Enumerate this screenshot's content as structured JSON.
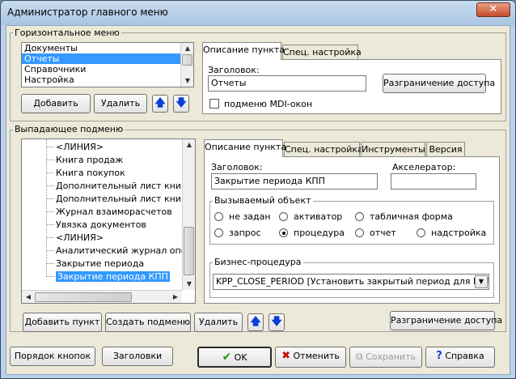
{
  "window": {
    "title": "Администратор главного меню",
    "close_glyph": "✕"
  },
  "horizontal_menu": {
    "group_label": "Горизонтальное меню",
    "items": [
      "Документы",
      "Отчеты",
      "Справочники",
      "Настройка"
    ],
    "selected_index": 1,
    "add_label": "Добавить",
    "delete_label": "Удалить",
    "tabs": [
      "Описание пункта",
      "Спец. настройка"
    ],
    "heading_label": "Заголовок:",
    "heading_value": "Отчеты",
    "access_label": "Разграничение доступа",
    "mdi_label": "подменю MDI-окон"
  },
  "dropdown_menu": {
    "group_label": "Выпадающее подменю",
    "tree_items": [
      "<ЛИНИЯ>",
      "Книга продаж",
      "Книга покупок",
      "Дополнительный лист книги п",
      "Дополнительный лист книги г",
      "Журнал взаиморасчетов",
      "Увязка документов",
      "<ЛИНИЯ>",
      "Аналитический журнал операц",
      "Закрытие периода",
      "Закрытие периода КПП"
    ],
    "selected_index": 10,
    "tabs": [
      "Описание пункта",
      "Спец. настройка",
      "Инструменты",
      "Версия"
    ],
    "heading_label": "Заголовок:",
    "heading_value": "Закрытие периода КПП",
    "accel_label": "Акселератор:",
    "accel_value": "",
    "object_group_label": "Вызываемый объект",
    "object_options": [
      "не задан",
      "активатор",
      "табличная форма",
      "запрос",
      "процедура",
      "отчет",
      "надстройка"
    ],
    "object_selected": "процедура",
    "bp_group_label": "Бизнес-процедура",
    "bp_value": "KPP_CLOSE_PERIOD [Установить закрытый период для КПП]",
    "add_item_label": "Добавить пункт",
    "create_sub_label": "Создать подменю",
    "delete_label": "Удалить",
    "access_label": "Разграничение доступа"
  },
  "footer": {
    "order_label": "Порядок кнопок",
    "headings_label": "Заголовки",
    "ok_label": "OK",
    "cancel_label": "Отменить",
    "save_label": "Сохранить",
    "help_label": "Справка"
  },
  "colors": {
    "accent_blue": "#0a3fd8",
    "ok_green": "#1a9a1a",
    "cancel_red": "#c01010",
    "selection": "#3399ff"
  }
}
